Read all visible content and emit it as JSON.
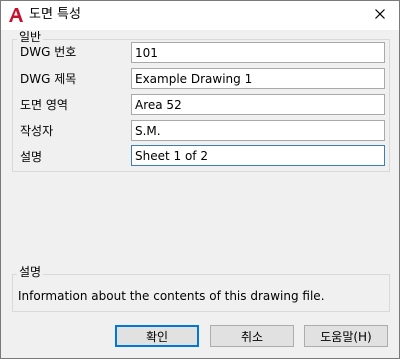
{
  "window": {
    "title": "도면 특성",
    "app_icon": "autocad-a-icon",
    "close_icon": "close-icon"
  },
  "general": {
    "group_title": "일반",
    "fields": [
      {
        "label": "DWG 번호",
        "value": "101"
      },
      {
        "label": "DWG 제목",
        "value": "Example Drawing 1"
      },
      {
        "label": "도면 영역",
        "value": "Area 52"
      },
      {
        "label": "작성자",
        "value": "S.M."
      },
      {
        "label": "설명",
        "value": "Sheet 1 of 2"
      }
    ]
  },
  "description": {
    "title": "설명",
    "text": "Information about the contents of this drawing file."
  },
  "buttons": {
    "ok": "확인",
    "cancel": "취소",
    "help": "도움말(H)"
  },
  "colors": {
    "accent": "#0078d7",
    "app_icon_red": "#c8102e"
  }
}
